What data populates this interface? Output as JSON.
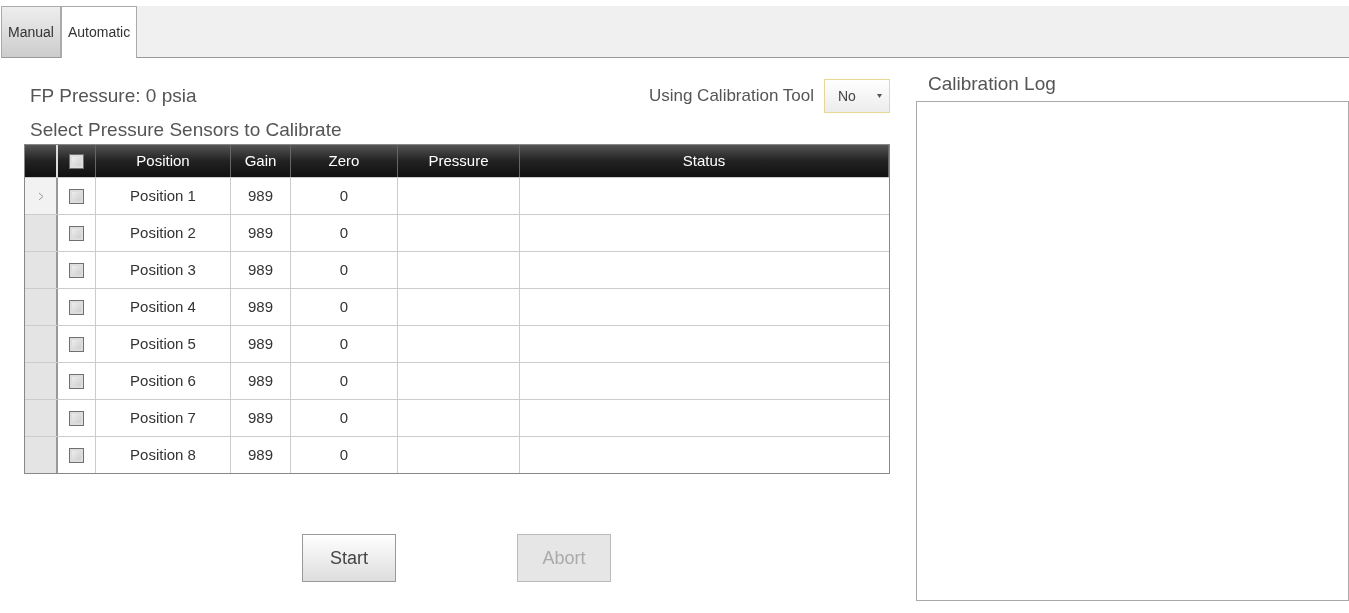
{
  "tabs": [
    {
      "label": "Manual",
      "selected": false
    },
    {
      "label": "Automatic",
      "selected": true
    }
  ],
  "fp_pressure": "FP Pressure: 0 psia",
  "calibration_tool": {
    "label": "Using Calibration Tool",
    "value": "No"
  },
  "table": {
    "title": "Select Pressure Sensors to Calibrate",
    "select_all_checked": false,
    "columns": [
      "Position",
      "Gain",
      "Zero",
      "Pressure",
      "Status"
    ],
    "rows": [
      {
        "current": true,
        "checked": false,
        "cells": [
          "Position 1",
          "989",
          "0"
        ]
      },
      {
        "current": false,
        "checked": false,
        "cells": [
          "Position 2",
          "989",
          "0"
        ]
      },
      {
        "current": false,
        "checked": false,
        "cells": [
          "Position 3",
          "989",
          "0"
        ]
      },
      {
        "current": false,
        "checked": false,
        "cells": [
          "Position 4",
          "989",
          "0"
        ]
      },
      {
        "current": false,
        "checked": false,
        "cells": [
          "Position 5",
          "989",
          "0"
        ]
      },
      {
        "current": false,
        "checked": false,
        "cells": [
          "Position 6",
          "989",
          "0"
        ]
      },
      {
        "current": false,
        "checked": false,
        "cells": [
          "Position 7",
          "989",
          "0"
        ]
      },
      {
        "current": false,
        "checked": false,
        "cells": [
          "Position 8",
          "989",
          "0"
        ]
      }
    ]
  },
  "buttons": [
    {
      "label": "Start",
      "disabled": false
    },
    {
      "label": "Abort",
      "disabled": true
    }
  ],
  "log": {
    "title": "Calibration Log"
  }
}
